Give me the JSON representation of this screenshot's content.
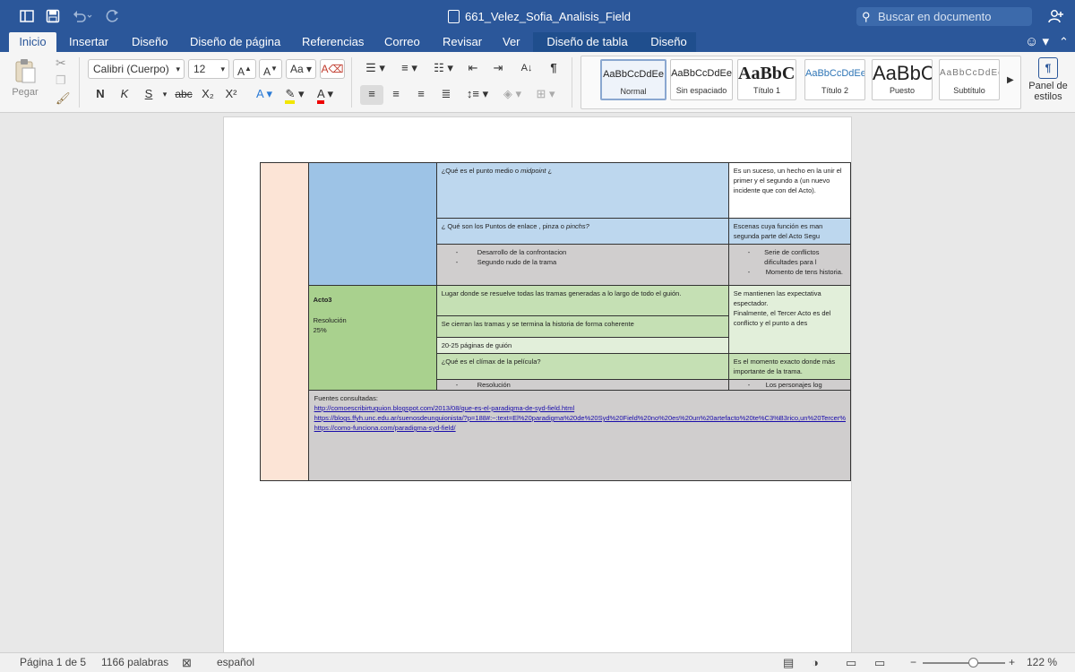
{
  "title_bar": {
    "document_title": "661_Velez_Sofia_Analisis_Field",
    "search_placeholder": "Buscar en documento",
    "icons": [
      "sidebar-icon",
      "save-icon",
      "undo-icon",
      "redo-icon",
      "word-doc-icon",
      "share-user-icon"
    ]
  },
  "tabs": [
    {
      "label": "Inicio",
      "active": true
    },
    {
      "label": "Insertar"
    },
    {
      "label": "Diseño"
    },
    {
      "label": "Diseño de página"
    },
    {
      "label": "Referencias"
    },
    {
      "label": "Correo"
    },
    {
      "label": "Revisar"
    },
    {
      "label": "Ver"
    },
    {
      "label": "Diseño de tabla",
      "contextual": true
    },
    {
      "label": "Diseño",
      "contextual": true
    }
  ],
  "ribbon": {
    "paste_label": "Pegar",
    "font_name": "Calibri (Cuerpo)",
    "font_size": "12",
    "bold": "N",
    "italic": "K",
    "underline": "S",
    "strikethrough": "abc",
    "subscript": "X₂",
    "superscript": "X²",
    "styles": [
      {
        "sample": "AaBbCcDdEe",
        "name": "Normal",
        "selected": true
      },
      {
        "sample": "AaBbCcDdEe",
        "name": "Sin espaciado"
      },
      {
        "sample": "AaBbC(",
        "name": "Título 1"
      },
      {
        "sample": "AaBbCcDdEe",
        "name": "Título 2"
      },
      {
        "sample": "AaBbC",
        "name": "Puesto"
      },
      {
        "sample": "AaBbCcDdEe",
        "name": "Subtítulo"
      }
    ],
    "styles_pane_label": "Panel de\nestilos",
    "accent_color": "#2b579a"
  },
  "document": {
    "table": {
      "colors": {
        "peach": "#fce4d6",
        "blue": "#9dc3e6",
        "light_blue": "#bdd7ee",
        "grey": "#d0cece",
        "green": "#a9d18e",
        "light_green": "#c5e0b4",
        "lighter_green": "#e2efda"
      },
      "r1": {
        "q": "¿Qué es el punto medio o ",
        "q_em": "midpoint",
        "q_end": " ¿",
        "a": "Es un suceso, un hecho en la unir el primer y el segundo a (un nuevo incidente que con del Acto)."
      },
      "r2": {
        "q": "¿ Qué son los Puntos de enlace , pinza  o ",
        "q_em": "pinchs?",
        "a": "Escenas cuya función es man segunda parte del Acto Segu"
      },
      "r3": {
        "bullets": [
          "Desarrollo de la confrontacion",
          "Segundo nudo de la trama"
        ],
        "a_bullets": [
          "Serie de conflictos dificultades para l",
          "Momento de tens historia."
        ]
      },
      "acto3": {
        "title": "Acto3",
        "subtitle": "Resolución",
        "percent": "25%"
      },
      "r4": {
        "q": "Lugar donde se resuelve todas las tramas generadas a lo largo de todo el guión.",
        "a": "Se mantienen las expectativa espectador.\nFinalmente, el Tercer Acto es del conflicto y el punto a des"
      },
      "r5": {
        "q": "Se cierran las tramas y se termina la historia de forma coherente"
      },
      "r6": {
        "q": "20-25 páginas de guión"
      },
      "r7": {
        "q": "¿Qué es el clímax de la película?",
        "a": "Es el momento exacto donde más importante de la trama."
      },
      "r8": {
        "bullet": "Resolución",
        "a_bullet": "Los personajes log"
      },
      "sources": {
        "heading": "Fuentes consultadas:",
        "links": [
          "http://comoescribirtuguion.blogspot.com/2013/08/que-es-el-paradigma-de-syd-field.html",
          "https://blogs.ffyh.unc.edu.ar/suenosdeunguionista/?p=188#:~:text=El%20paradigma%20de%20Syd%20Field%20no%20es%20un%20artefacto%20te%C3%B3rico,un%20Tercer%",
          "https://como-funciona.com/paradigma-syd-field/"
        ]
      }
    }
  },
  "status_bar": {
    "page": "Página 1 de 5",
    "words": "1166 palabras",
    "language": "español",
    "zoom": "122 %",
    "zoom_level": 0.61
  }
}
